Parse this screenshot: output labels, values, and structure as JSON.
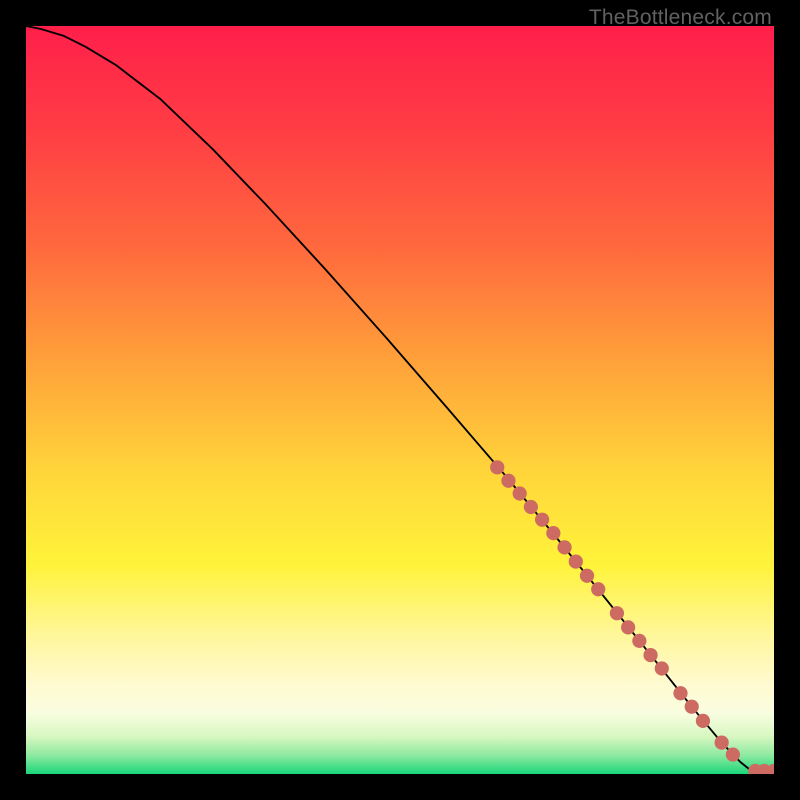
{
  "watermark": {
    "text": "TheBottleneck.com"
  },
  "chart_data": {
    "type": "line",
    "title": "",
    "xlabel": "",
    "ylabel": "",
    "xlim": [
      0,
      100
    ],
    "ylim": [
      0,
      100
    ],
    "gradient_stops": [
      {
        "pos": 0.0,
        "color": "#ff1f4a"
      },
      {
        "pos": 0.15,
        "color": "#ff4044"
      },
      {
        "pos": 0.3,
        "color": "#ff6a3d"
      },
      {
        "pos": 0.45,
        "color": "#ffa23a"
      },
      {
        "pos": 0.6,
        "color": "#ffd63a"
      },
      {
        "pos": 0.72,
        "color": "#fff33a"
      },
      {
        "pos": 0.82,
        "color": "#fff7a0"
      },
      {
        "pos": 0.88,
        "color": "#fffad0"
      },
      {
        "pos": 0.92,
        "color": "#f8fde0"
      },
      {
        "pos": 0.95,
        "color": "#d6f7c0"
      },
      {
        "pos": 0.975,
        "color": "#8ee9a0"
      },
      {
        "pos": 1.0,
        "color": "#19d67a"
      }
    ],
    "series": [
      {
        "name": "bottleneck-curve",
        "x": [
          0,
          2,
          5,
          8,
          12,
          18,
          25,
          32,
          40,
          48,
          56,
          64,
          71,
          78,
          84,
          89,
          93,
          95.5,
          97,
          100
        ],
        "y": [
          100,
          99.6,
          98.7,
          97.2,
          94.8,
          90.2,
          83.5,
          76.2,
          67.5,
          58.5,
          49.3,
          40.0,
          31.5,
          22.8,
          15.3,
          9.0,
          4.2,
          1.6,
          0.4,
          0.4
        ]
      }
    ],
    "highlight_points": {
      "name": "sample-dots",
      "color": "#cd6a62",
      "points": [
        {
          "x": 63.0,
          "y": 41.0
        },
        {
          "x": 64.5,
          "y": 39.2
        },
        {
          "x": 66.0,
          "y": 37.5
        },
        {
          "x": 67.5,
          "y": 35.7
        },
        {
          "x": 69.0,
          "y": 34.0
        },
        {
          "x": 70.5,
          "y": 32.2
        },
        {
          "x": 72.0,
          "y": 30.3
        },
        {
          "x": 73.5,
          "y": 28.4
        },
        {
          "x": 75.0,
          "y": 26.5
        },
        {
          "x": 76.5,
          "y": 24.7
        },
        {
          "x": 79.0,
          "y": 21.5
        },
        {
          "x": 80.5,
          "y": 19.6
        },
        {
          "x": 82.0,
          "y": 17.8
        },
        {
          "x": 83.5,
          "y": 15.9
        },
        {
          "x": 85.0,
          "y": 14.1
        },
        {
          "x": 87.5,
          "y": 10.8
        },
        {
          "x": 89.0,
          "y": 9.0
        },
        {
          "x": 90.5,
          "y": 7.1
        },
        {
          "x": 93.0,
          "y": 4.2
        },
        {
          "x": 94.5,
          "y": 2.6
        },
        {
          "x": 97.5,
          "y": 0.4
        },
        {
          "x": 98.7,
          "y": 0.4
        },
        {
          "x": 100.0,
          "y": 0.4
        }
      ]
    }
  }
}
